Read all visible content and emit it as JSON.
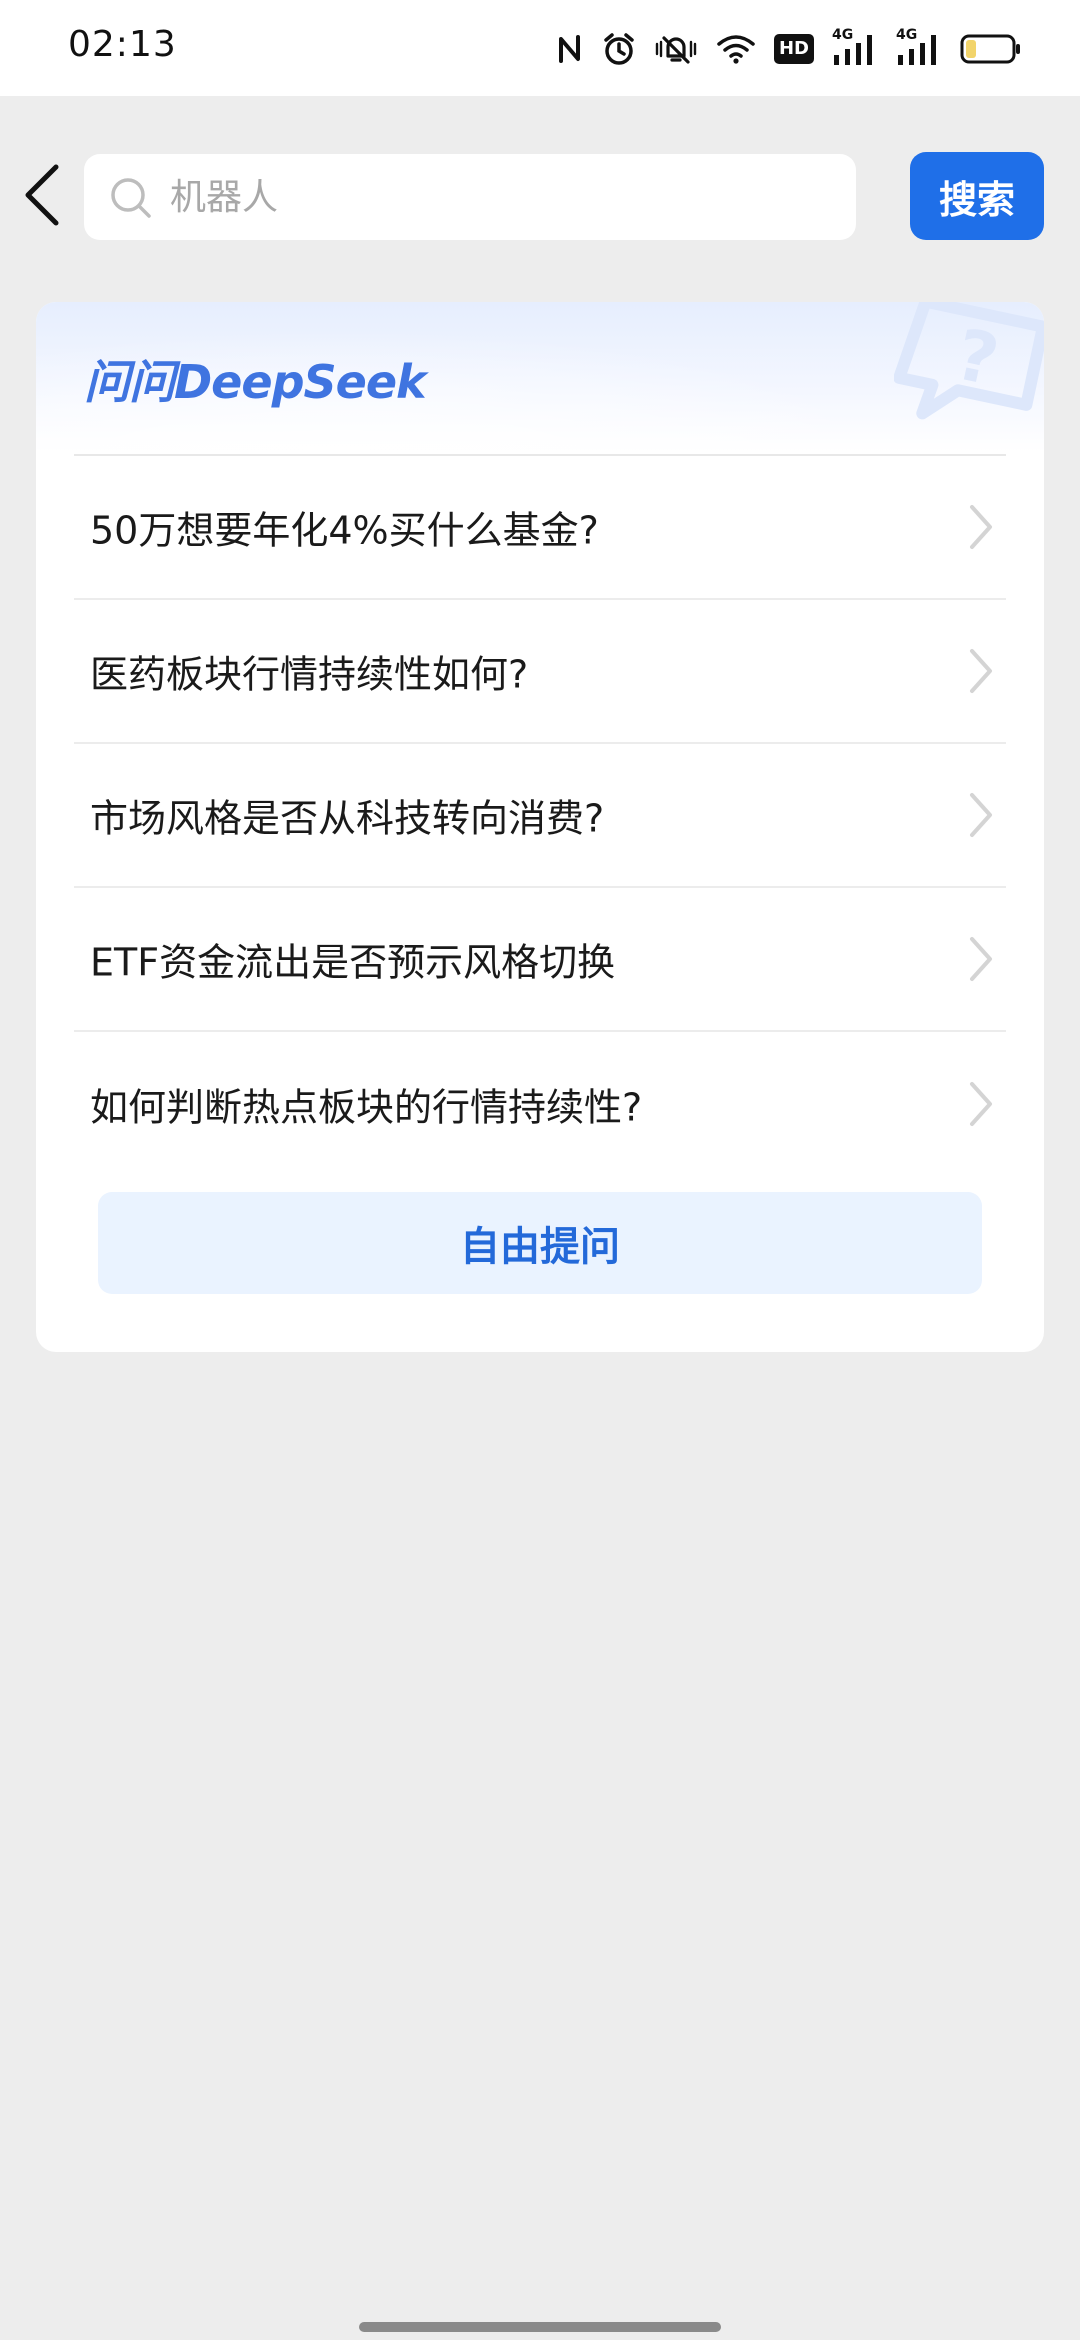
{
  "status_bar": {
    "time": "02:13",
    "icons": [
      "nfc-icon",
      "alarm-icon",
      "mute-icon",
      "wifi-icon",
      "hd-icon",
      "signal-4g-icon",
      "signal-4g-icon",
      "battery-icon"
    ],
    "hd_label": "HD",
    "network_1": "4G",
    "network_2": "4G"
  },
  "search": {
    "placeholder": "机器人",
    "button_label": "搜索"
  },
  "card": {
    "title": "问问DeepSeek",
    "questions": [
      {
        "text": "50万想要年化4%买什么基金?"
      },
      {
        "text": "医药板块行情持续性如何?"
      },
      {
        "text": "市场风格是否从科技转向消费?"
      },
      {
        "text": "ETF资金流出是否预示风格切换"
      },
      {
        "text": "如何判断热点板块的行情持续性?"
      }
    ],
    "ask_button_label": "自由提问"
  },
  "colors": {
    "accent": "#1f6fe8",
    "title_blue": "#3f74e0",
    "ask_bg": "#eaf3ff",
    "page_bg": "#ededed"
  }
}
